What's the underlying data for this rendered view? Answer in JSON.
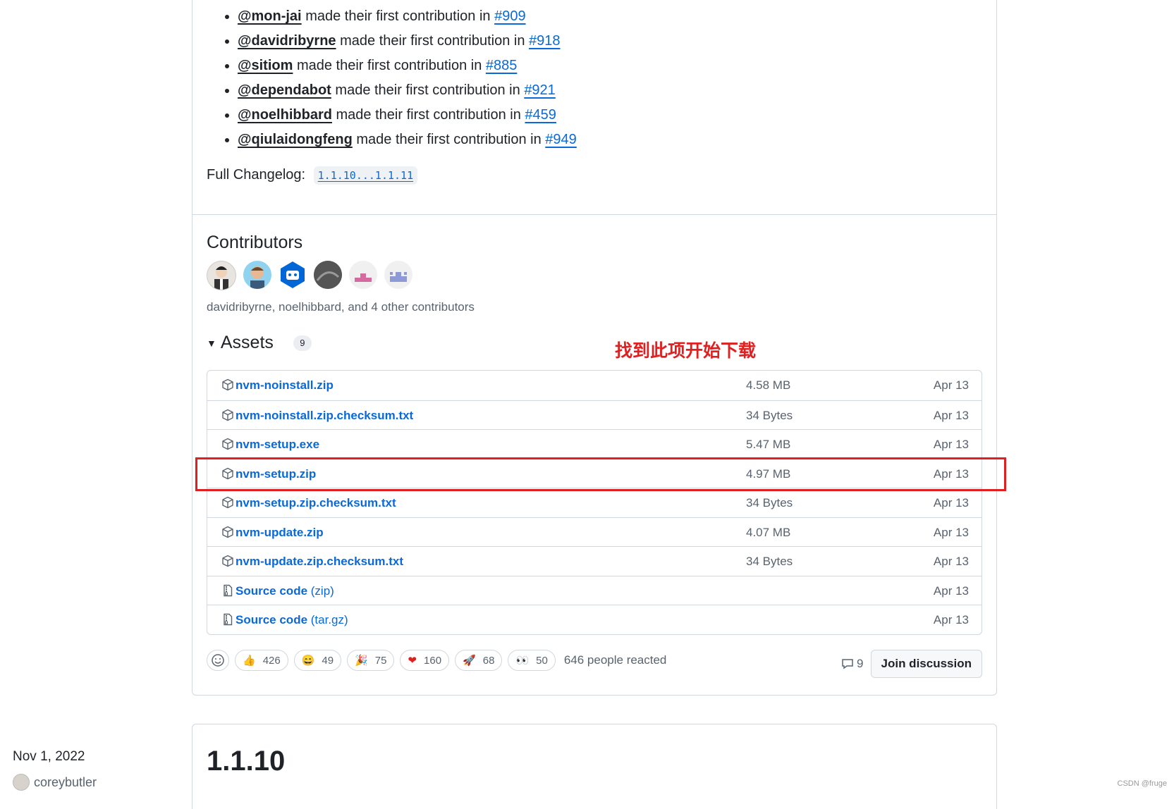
{
  "first_contributions": [
    {
      "user": "@mon-jai",
      "text": "made their first contribution in",
      "pr": "#909"
    },
    {
      "user": "@davidribyrne",
      "text": "made their first contribution in",
      "pr": "#918"
    },
    {
      "user": "@sitiom",
      "text": "made their first contribution in",
      "pr": "#885"
    },
    {
      "user": "@dependabot",
      "text": "made their first contribution in",
      "pr": "#921"
    },
    {
      "user": "@noelhibbard",
      "text": "made their first contribution in",
      "pr": "#459"
    },
    {
      "user": "@qiulaidongfeng",
      "text": "made their first contribution in",
      "pr": "#949"
    }
  ],
  "changelog": {
    "label": "Full Changelog:",
    "link": "1.1.10...1.1.11"
  },
  "contributors": {
    "title": "Contributors",
    "summary": "davidribyrne, noelhibbard, and 4 other contributors"
  },
  "assets": {
    "title": "Assets",
    "count": "9",
    "rows": [
      {
        "name": "nvm-noinstall.zip",
        "suffix": "",
        "size": "4.58 MB",
        "date": "Apr 13",
        "icon": "package-icon"
      },
      {
        "name": "nvm-noinstall.zip.checksum.txt",
        "suffix": "",
        "size": "34 Bytes",
        "date": "Apr 13",
        "icon": "package-icon"
      },
      {
        "name": "nvm-setup.exe",
        "suffix": "",
        "size": "5.47 MB",
        "date": "Apr 13",
        "icon": "package-icon"
      },
      {
        "name": "nvm-setup.zip",
        "suffix": "",
        "size": "4.97 MB",
        "date": "Apr 13",
        "icon": "package-icon"
      },
      {
        "name": "nvm-setup.zip.checksum.txt",
        "suffix": "",
        "size": "34 Bytes",
        "date": "Apr 13",
        "icon": "package-icon"
      },
      {
        "name": "nvm-update.zip",
        "suffix": "",
        "size": "4.07 MB",
        "date": "Apr 13",
        "icon": "package-icon"
      },
      {
        "name": "nvm-update.zip.checksum.txt",
        "suffix": "",
        "size": "34 Bytes",
        "date": "Apr 13",
        "icon": "package-icon"
      },
      {
        "name": "Source code",
        "suffix": " (zip)",
        "size": "",
        "date": "Apr 13",
        "icon": "file-zip-icon"
      },
      {
        "name": "Source code",
        "suffix": " (tar.gz)",
        "size": "",
        "date": "Apr 13",
        "icon": "file-zip-icon"
      }
    ]
  },
  "annotation": {
    "text": "找到此项开始下载",
    "color": "#e02020"
  },
  "reactions": {
    "items": [
      {
        "emoji": "👍",
        "count": "426"
      },
      {
        "emoji": "😄",
        "count": "49"
      },
      {
        "emoji": "🎉",
        "count": "75"
      },
      {
        "emoji": "❤",
        "count": "160"
      },
      {
        "emoji": "🚀",
        "count": "68"
      },
      {
        "emoji": "👀",
        "count": "50"
      }
    ],
    "summary": "646 people reacted"
  },
  "discussion": {
    "comments": "9",
    "join_label": "Join discussion"
  },
  "next_release": {
    "version": "1.1.10",
    "date": "Nov 1, 2022",
    "author": "coreybutler"
  },
  "watermark": "CSDN @fruge",
  "colors": {
    "link": "#0969da",
    "annotation": "#e02020",
    "border": "#d0d7de"
  }
}
